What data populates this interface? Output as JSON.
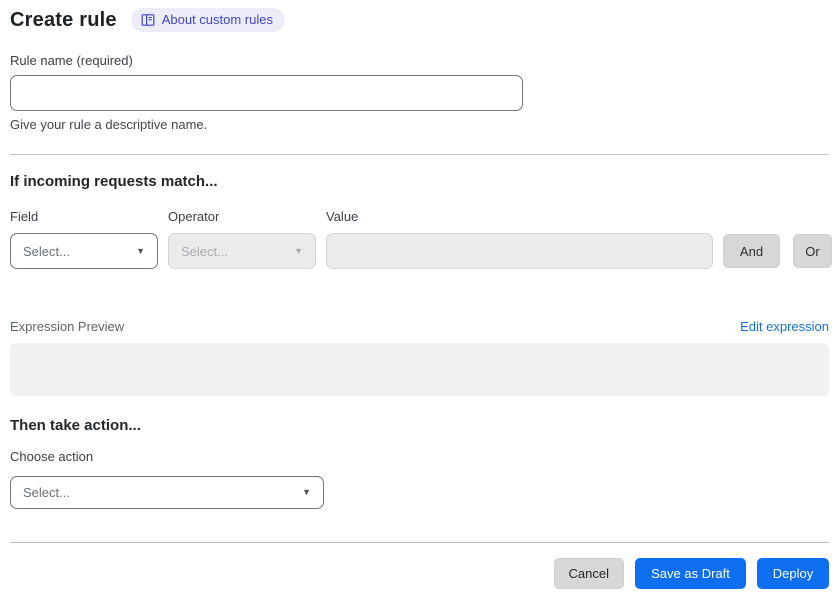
{
  "header": {
    "title": "Create rule",
    "about_link": {
      "label": "About custom rules",
      "icon": "book-icon"
    }
  },
  "rule_name": {
    "label": "Rule name (required)",
    "value": "",
    "placeholder": "",
    "helper": "Give your rule a descriptive name."
  },
  "match_section": {
    "heading": "If incoming requests match...",
    "field": {
      "label": "Field",
      "selected": "Select...",
      "enabled": true
    },
    "operator": {
      "label": "Operator",
      "selected": "Select...",
      "enabled": false
    },
    "value": {
      "label": "Value",
      "value": "",
      "enabled": false
    },
    "and_label": "And",
    "or_label": "Or",
    "expression_preview_label": "Expression Preview",
    "edit_expression_label": "Edit expression",
    "expression_value": ""
  },
  "action_section": {
    "heading": "Then take action...",
    "choose_label": "Choose action",
    "selected": "Select..."
  },
  "footer": {
    "cancel_label": "Cancel",
    "save_draft_label": "Save as Draft",
    "deploy_label": "Deploy"
  },
  "colors": {
    "primary_button": "#0d6ef0",
    "link": "#1570d6",
    "badge_bg": "#ededfa",
    "badge_text": "#3e45c6",
    "disabled_bg": "#ebebec",
    "gray_button_bg": "#d6d7d8"
  }
}
